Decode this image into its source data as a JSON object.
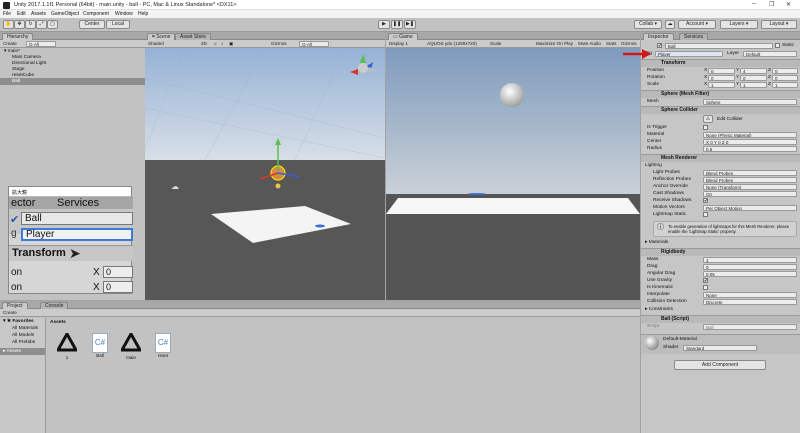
{
  "window": {
    "title": "Unity 2017.1.1f1 Personal (64bit) - main.unity - ball - PC, Mac & Linux Standalone* <DX11>"
  },
  "menu": [
    "File",
    "Edit",
    "Assets",
    "GameObject",
    "Component",
    "Window",
    "Help"
  ],
  "toolbar": {
    "center": "Center",
    "local": "Local",
    "collab": "Collab",
    "account": "Account",
    "layers": "Layers",
    "layout": "Layout"
  },
  "hierarchy": {
    "tab": "Hierarchy",
    "create": "Create",
    "search": "Q·All",
    "scene": "main*",
    "items": [
      "Main Camera",
      "Directional Light",
      "Stage",
      "resetCube",
      "Ball"
    ]
  },
  "scene": {
    "tab": "Scene",
    "tab2": "Asset Store",
    "shading": "Shaded",
    "mode": "2D",
    "gizmos": "Gizmos",
    "search": "Q·All"
  },
  "game": {
    "tab": "Game",
    "display": "Display 1",
    "res": "AQUOS ydo (1280x720)",
    "scale": "Scale",
    "maximize": "Maximize On Play",
    "mute": "Mute Audio",
    "stats": "Stats",
    "gizmos": "Gizmos"
  },
  "zoom": {
    "title": "拡大鏡",
    "tab_left": "ector",
    "tab_right": "Services",
    "name": "Ball",
    "tag_prefix": "g",
    "tag": "Player",
    "transform": "Transform",
    "row1": "on",
    "row2": "on",
    "x": "X",
    "v1": "0",
    "v2": "0"
  },
  "project": {
    "tab": "Project",
    "tab2": "Console",
    "create": "Create",
    "favorites": "Favorites",
    "fav_items": [
      "All Materials",
      "All Models",
      "All Prefabs"
    ],
    "assets": "Assets",
    "assets_header": "Assets",
    "files": [
      {
        "name": "1",
        "type": "unity"
      },
      {
        "name": "Ball",
        "type": "cs"
      },
      {
        "name": "main",
        "type": "unity"
      },
      {
        "name": "reset",
        "type": "cs"
      }
    ]
  },
  "inspector": {
    "tab": "Inspector",
    "tab2": "Services",
    "name": "Ball",
    "static": "Static",
    "tag_label": "Tag",
    "tag": "Player",
    "layer_label": "Layer",
    "layer": "Default",
    "transform": {
      "title": "Transform",
      "rows": [
        {
          "label": "Position",
          "x": "0",
          "y": "4",
          "z": "0"
        },
        {
          "label": "Rotation",
          "x": "0",
          "y": "0",
          "z": "0"
        },
        {
          "label": "Scale",
          "x": "1",
          "y": "1",
          "z": "1"
        }
      ]
    },
    "mesh_filter": {
      "title": "Sphere (Mesh Filter)",
      "label": "Mesh",
      "value": "Sphere"
    },
    "collider": {
      "title": "Sphere Collider",
      "edit": "Edit Collider",
      "rows": [
        {
          "label": "Is Trigger",
          "value": ""
        },
        {
          "label": "Material",
          "value": "None (Physic Material)"
        },
        {
          "label": "Center",
          "value": "X 0   Y 0   Z 0"
        },
        {
          "label": "Radius",
          "value": "0.5"
        }
      ]
    },
    "renderer": {
      "title": "Mesh Renderer",
      "lighting": "Lighting",
      "rows": [
        {
          "label": "Light Probes",
          "value": "Blend Probes"
        },
        {
          "label": "Reflection Probes",
          "value": "Blend Probes"
        },
        {
          "label": "Anchor Override",
          "value": "None (Transform)"
        },
        {
          "label": "Cast Shadows",
          "value": "On"
        },
        {
          "label": "Receive Shadows",
          "value": "✔"
        },
        {
          "label": "Motion Vectors",
          "value": "Per Object Motion"
        },
        {
          "label": "Lightmap Static",
          "value": ""
        }
      ],
      "info": "To enable generation of lightmaps for this Mesh Renderer, please enable the 'Lightmap Static' property.",
      "materials": "Materials"
    },
    "rigidbody": {
      "title": "Rigidbody",
      "rows": [
        {
          "label": "Mass",
          "value": "1"
        },
        {
          "label": "Drag",
          "value": "0"
        },
        {
          "label": "Angular Drag",
          "value": "0.05"
        },
        {
          "label": "Use Gravity",
          "value": "✔"
        },
        {
          "label": "Is Kinematic",
          "value": ""
        },
        {
          "label": "Interpolate",
          "value": "None"
        },
        {
          "label": "Collision Detection",
          "value": "Discrete"
        }
      ],
      "constraints": "Constraints"
    },
    "script": {
      "title": "Ball (Script)",
      "label": "Script",
      "value": "Ball"
    },
    "material": {
      "name": "Default-Material",
      "shader_label": "Shader",
      "shader": "Standard"
    },
    "add_component": "Add Component"
  },
  "colors": {
    "arrow": "#d01818",
    "select": "#3d7bd9"
  }
}
